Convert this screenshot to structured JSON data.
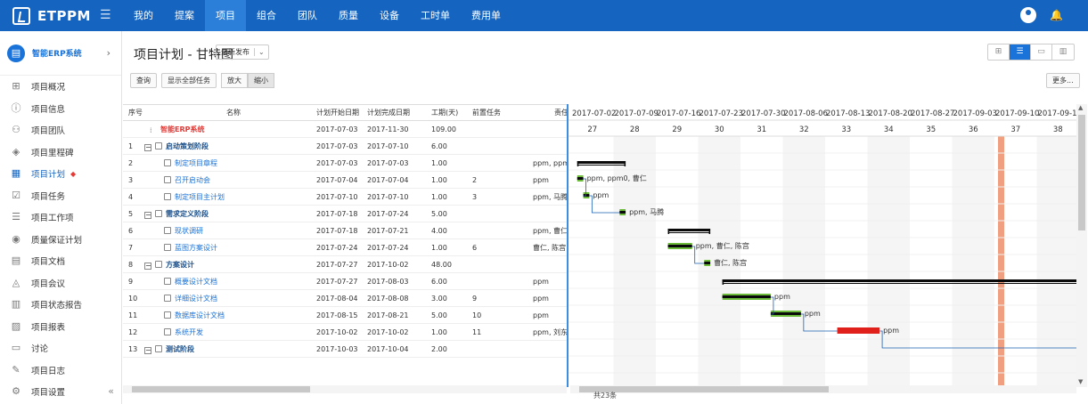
{
  "brand": {
    "name": "ETPPM"
  },
  "nav": [
    "我的",
    "提案",
    "项目",
    "组合",
    "团队",
    "质量",
    "设备",
    "工时单",
    "费用单"
  ],
  "nav_active": 2,
  "sidebar": {
    "project": "智能ERP系统",
    "items": [
      {
        "label": "项目概况",
        "icon": "grid-icon"
      },
      {
        "label": "项目信息",
        "icon": "info-icon"
      },
      {
        "label": "项目团队",
        "icon": "team-icon"
      },
      {
        "label": "项目里程碑",
        "icon": "milestone-icon"
      },
      {
        "label": "项目计划",
        "icon": "plan-icon",
        "active": true
      },
      {
        "label": "项目任务",
        "icon": "task-icon"
      },
      {
        "label": "项目工作项",
        "icon": "workitem-icon"
      },
      {
        "label": "质量保证计划",
        "icon": "quality-icon"
      },
      {
        "label": "项目文档",
        "icon": "document-icon"
      },
      {
        "label": "项目会议",
        "icon": "meeting-icon"
      },
      {
        "label": "项目状态报告",
        "icon": "report-icon"
      },
      {
        "label": "项目报表",
        "icon": "chart-icon"
      },
      {
        "label": "讨论",
        "icon": "chat-icon"
      },
      {
        "label": "项目日志",
        "icon": "log-icon"
      },
      {
        "label": "项目设置",
        "icon": "settings-icon"
      }
    ]
  },
  "page": {
    "title": "项目计划 - 甘特图",
    "release": "最新发布"
  },
  "toolbar": {
    "query": "查询",
    "show_all": "显示全部任务",
    "zoom_in": "放大",
    "zoom_out": "缩小",
    "more": "更多..."
  },
  "grid": {
    "headers": {
      "no": "序号",
      "name": "名称",
      "start": "计划开始日期",
      "end": "计划完成日期",
      "work": "工期(天)",
      "pre": "前置任务",
      "res": "责任"
    },
    "rows": [
      {
        "no": "",
        "name": "智能ERP系统",
        "type": "root",
        "start": "2017-07-03",
        "end": "2017-11-30",
        "work": "109.00",
        "pre": "",
        "res": ""
      },
      {
        "no": "1",
        "name": "启动策划阶段",
        "type": "phase",
        "start": "2017-07-03",
        "end": "2017-07-10",
        "work": "6.00",
        "pre": "",
        "res": ""
      },
      {
        "no": "2",
        "name": "制定项目章程",
        "type": "task",
        "start": "2017-07-03",
        "end": "2017-07-03",
        "work": "1.00",
        "pre": "",
        "res": "ppm, ppm"
      },
      {
        "no": "3",
        "name": "召开启动会",
        "type": "task",
        "start": "2017-07-04",
        "end": "2017-07-04",
        "work": "1.00",
        "pre": "2",
        "res": "ppm"
      },
      {
        "no": "4",
        "name": "制定项目主计划",
        "type": "task",
        "start": "2017-07-10",
        "end": "2017-07-10",
        "work": "1.00",
        "pre": "3",
        "res": "ppm, 马腾"
      },
      {
        "no": "5",
        "name": "需求定义阶段",
        "type": "phase",
        "start": "2017-07-18",
        "end": "2017-07-24",
        "work": "5.00",
        "pre": "",
        "res": ""
      },
      {
        "no": "6",
        "name": "现状调研",
        "type": "task",
        "start": "2017-07-18",
        "end": "2017-07-21",
        "work": "4.00",
        "pre": "",
        "res": "ppm, 曹仁"
      },
      {
        "no": "7",
        "name": "蓝图方案设计",
        "type": "task",
        "start": "2017-07-24",
        "end": "2017-07-24",
        "work": "1.00",
        "pre": "6",
        "res": "曹仁, 陈宫"
      },
      {
        "no": "8",
        "name": "方案设计",
        "type": "phase",
        "start": "2017-07-27",
        "end": "2017-10-02",
        "work": "48.00",
        "pre": "",
        "res": ""
      },
      {
        "no": "9",
        "name": "概要设计文档",
        "type": "task",
        "start": "2017-07-27",
        "end": "2017-08-03",
        "work": "6.00",
        "pre": "",
        "res": "ppm"
      },
      {
        "no": "10",
        "name": "详细设计文档",
        "type": "task",
        "start": "2017-08-04",
        "end": "2017-08-08",
        "work": "3.00",
        "pre": "9",
        "res": "ppm"
      },
      {
        "no": "11",
        "name": "数据库设计文档",
        "type": "task",
        "start": "2017-08-15",
        "end": "2017-08-21",
        "work": "5.00",
        "pre": "10",
        "res": "ppm"
      },
      {
        "no": "12",
        "name": "系统开发",
        "type": "task",
        "start": "2017-10-02",
        "end": "2017-10-02",
        "work": "1.00",
        "pre": "11",
        "res": "ppm, 刘东"
      },
      {
        "no": "13",
        "name": "测试阶段",
        "type": "phase",
        "start": "2017-10-03",
        "end": "2017-10-04",
        "work": "2.00",
        "pre": "",
        "res": ""
      }
    ]
  },
  "gantt": {
    "weeks": [
      "2017-07-02",
      "2017-07-09",
      "2017-07-16",
      "2017-07-23",
      "2017-07-30",
      "2017-08-06",
      "2017-08-13",
      "2017-08-20",
      "2017-08-27",
      "2017-09-03",
      "2017-09-10",
      "2017-09-1"
    ],
    "week_nums": [
      "27",
      "28",
      "29",
      "30",
      "31",
      "32",
      "33",
      "34",
      "35",
      "36",
      "37",
      "38"
    ],
    "today_col": 10,
    "labels": [
      "ppm, ppm0, 曹仁",
      "ppm",
      "ppm, 马腾",
      "ppm, 曹仁, 陈宫",
      "曹仁, 陈宫",
      "ppm",
      "ppm",
      "ppm"
    ],
    "colors": {
      "done": "#6dbb3a",
      "bar": "#0a0a0a",
      "late": "#e0201b",
      "today": "#f0a080",
      "link": "#1a5fb4"
    }
  },
  "footer": {
    "count": "共23条"
  }
}
